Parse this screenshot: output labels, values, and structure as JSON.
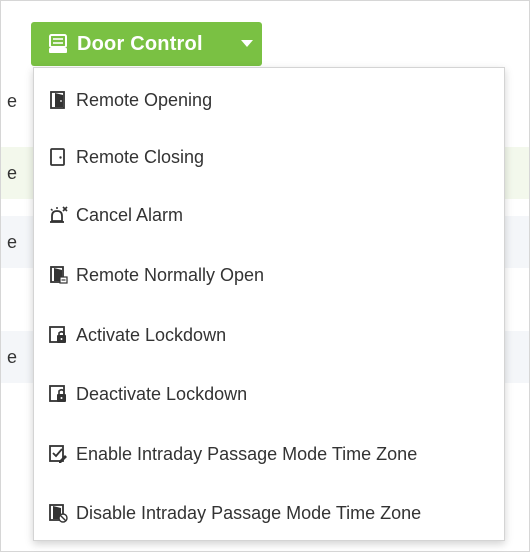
{
  "door_control": {
    "label": "Door Control",
    "icon": "door-panel-icon",
    "color": "#7ac143"
  },
  "background_rows": [
    {
      "text": "e",
      "bg": "#ffffff"
    },
    {
      "text": "e",
      "bg": "#f5f5f5"
    },
    {
      "text": "e",
      "bg": "#ffffff"
    },
    {
      "text": "",
      "bg": "#f5f5f5"
    },
    {
      "text": "e",
      "bg": "#ffffff"
    },
    {
      "text": "",
      "bg": "#f5f5f5"
    },
    {
      "text": "",
      "bg": "#ffffff"
    }
  ],
  "menu": {
    "items": [
      {
        "label": "Remote Opening",
        "icon": "door-open-icon"
      },
      {
        "label": "Remote Closing",
        "icon": "door-closed-icon"
      },
      {
        "label": "Cancel Alarm",
        "icon": "alarm-cancel-icon"
      },
      {
        "label": "Remote Normally Open",
        "icon": "door-normally-open-icon"
      },
      {
        "label": "Activate Lockdown",
        "icon": "lock-closed-icon"
      },
      {
        "label": "Deactivate Lockdown",
        "icon": "lock-open-icon"
      },
      {
        "label": "Enable Intraday Passage Mode Time Zone",
        "icon": "passage-enable-icon"
      },
      {
        "label": "Disable Intraday Passage Mode Time Zone",
        "icon": "passage-disable-icon"
      }
    ]
  }
}
